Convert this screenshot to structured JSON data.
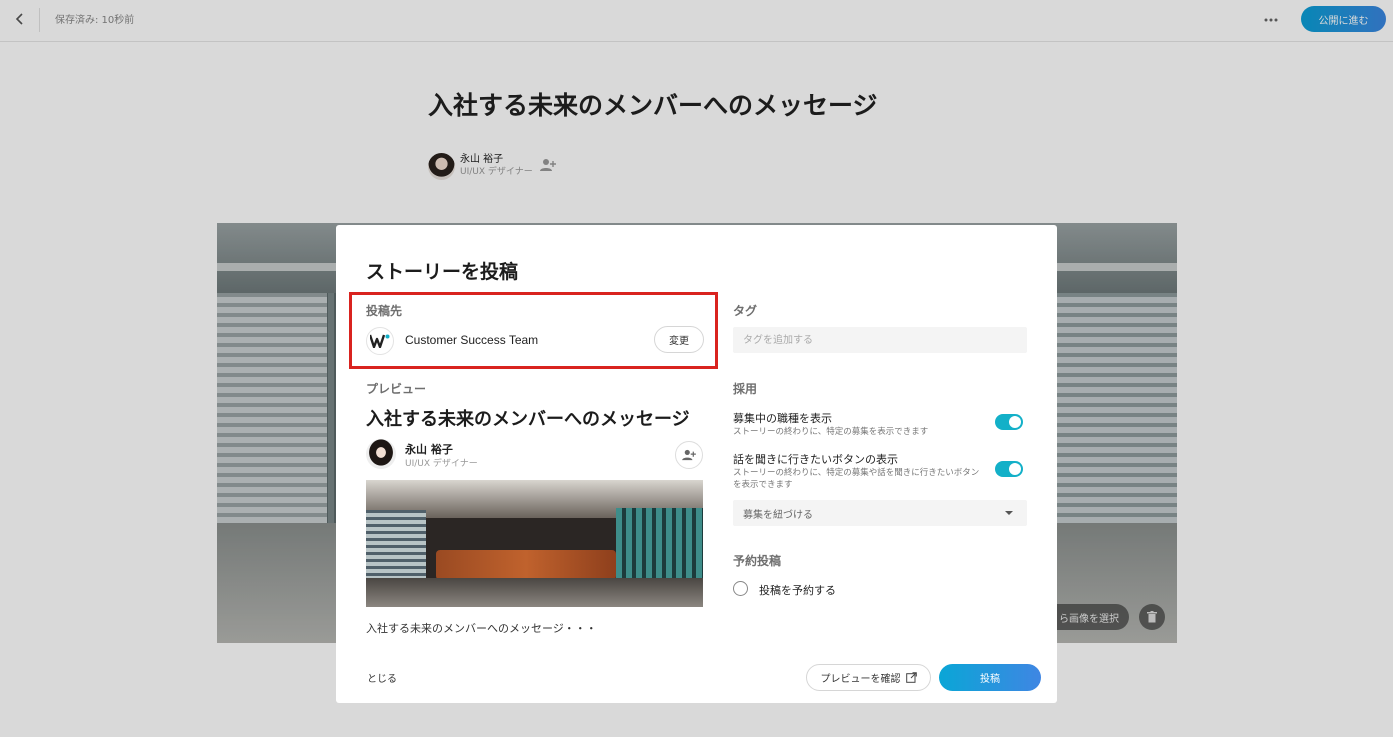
{
  "editor": {
    "saved_status": "保存済み: 10秒前",
    "publish_label": "公開に進む",
    "story_title": "入社する未来のメンバーへのメッセージ",
    "author_name": "永山 裕子",
    "author_role": "UI/UX デザイナー",
    "select_image_label": "ら画像を選択"
  },
  "modal": {
    "title": "ストーリーを投稿",
    "destination": {
      "label": "投稿先",
      "team_name": "Customer Success Team",
      "change_label": "変更"
    },
    "preview": {
      "label": "プレビュー",
      "title": "入社する未来のメンバーへのメッセージ",
      "author_name": "永山 裕子",
      "author_role": "UI/UX デザイナー",
      "excerpt": "入社する未来のメンバーへのメッセージ・・・"
    },
    "tags": {
      "label": "タグ",
      "placeholder": "タグを追加する",
      "value": ""
    },
    "recruit": {
      "label": "採用",
      "options": [
        {
          "title": "募集中の職種を表示",
          "description": "ストーリーの終わりに、特定の募集を表示できます",
          "enabled": true
        },
        {
          "title": "話を聞きに行きたいボタンの表示",
          "description": "ストーリーの終わりに、特定の募集や話を聞きに行きたいボタンを表示できます",
          "enabled": true
        }
      ],
      "job_select_placeholder": "募集を紐づける"
    },
    "schedule": {
      "label": "予約投稿",
      "option_label": "投稿を予約する",
      "checked": false
    },
    "footer": {
      "close_label": "とじる",
      "preview_button_label": "プレビューを確認",
      "post_button_label": "投稿"
    }
  },
  "colors": {
    "accent": "#13b0c8",
    "primary_gradient_start": "#0aa6d6",
    "primary_gradient_end": "#3f86e3",
    "highlight_border": "#d9231f"
  }
}
